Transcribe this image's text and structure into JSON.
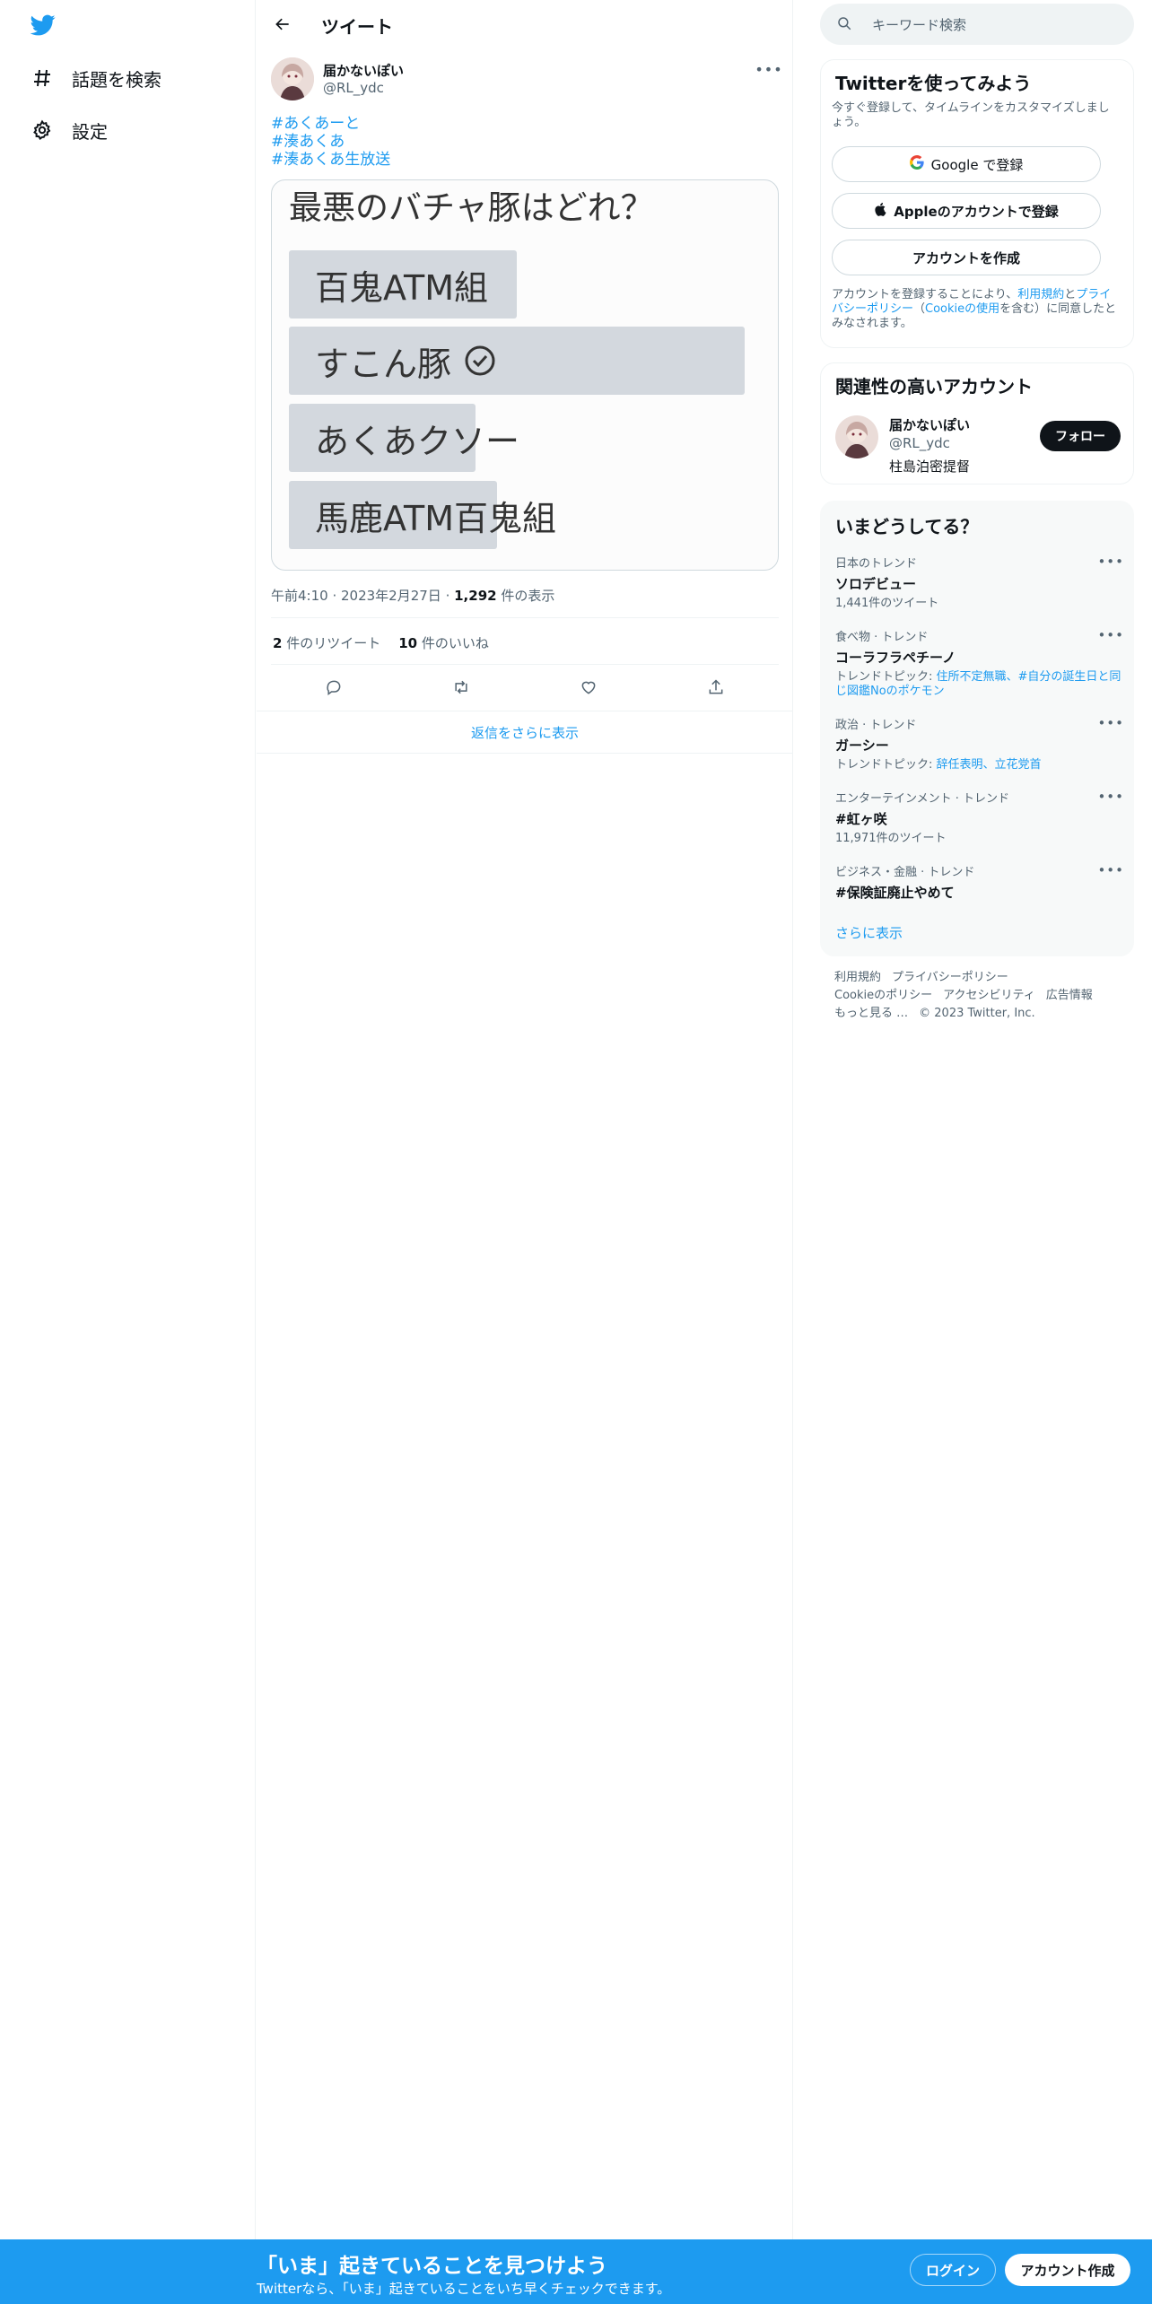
{
  "nav": {
    "items": [
      {
        "label": "話題を検索",
        "icon": "hashtag-icon"
      },
      {
        "label": "設定",
        "icon": "gear-icon"
      }
    ]
  },
  "header": {
    "title": "ツイート"
  },
  "tweet": {
    "author_name": "届かないぽい",
    "author_handle": "@RL_ydc",
    "hashtags": [
      "#あくあーと",
      "#湊あくあ",
      "#湊あくあ生放送"
    ],
    "poll_image": {
      "title": "最悪のバチャ豚はどれ？",
      "options": [
        {
          "label": "百鬼ATM組",
          "fill": 0.5,
          "checked": false
        },
        {
          "label": "すこん豚",
          "fill": 1.0,
          "checked": true
        },
        {
          "label": "あくあクソー",
          "fill": 0.41,
          "checked": false
        },
        {
          "label": "馬鹿ATM百鬼組",
          "fill": 0.46,
          "checked": false
        }
      ]
    },
    "time": "午前4:10",
    "date": "2023年2月27日",
    "views_count": "1,292",
    "views_label": "件の表示",
    "retweets_count": "2",
    "retweets_label": "件のリツイート",
    "likes_count": "10",
    "likes_label": "件のいいね",
    "more_replies": "返信をさらに表示"
  },
  "search": {
    "placeholder": "キーワード検索"
  },
  "signup_card": {
    "title": "Twitterを使ってみよう",
    "subtitle": "今すぐ登録して、タイムラインをカスタマイズしましょう。",
    "google_label": "Google で登録",
    "apple_label": "Appleのアカウントで登録",
    "create_label": "アカウントを作成",
    "terms_prefix": "アカウントを登録することにより、",
    "terms_link": "利用規約",
    "terms_and": "と",
    "privacy_link": "プライバシーポリシー",
    "cookie_paren_open": "（",
    "cookie_link": "Cookieの使用",
    "terms_suffix": "を含む）に同意したとみなされます。"
  },
  "related_card": {
    "title": "関連性の高いアカウント",
    "name": "届かないぽい",
    "handle": "@RL_ydc",
    "bio": "柱島泊密提督",
    "follow_label": "フォロー"
  },
  "trends_card": {
    "title": "いまどうしてる？",
    "trends": [
      {
        "category": "日本のトレンド",
        "name": "ソロデビュー",
        "sub": "1,441件のツイート"
      },
      {
        "category": "食べ物 · トレンド",
        "name": "コーラフラペチーノ",
        "sub_prefix": "トレンドトピック: ",
        "sub_links": "住所不定無職、#自分の誕生日と同じ図鑑Noのポケモン"
      },
      {
        "category": "政治 · トレンド",
        "name": "ガーシー",
        "sub_prefix": "トレンドトピック: ",
        "sub_links": "辞任表明、立花党首"
      },
      {
        "category": "エンターテインメント · トレンド",
        "name": "#虹ヶ咲",
        "sub": "11,971件のツイート"
      },
      {
        "category": "ビジネス・金融 · トレンド",
        "name": "#保険証廃止やめて",
        "sub": ""
      }
    ],
    "show_more": "さらに表示"
  },
  "footer": {
    "links": [
      "利用規約",
      "プライバシーポリシー",
      "Cookieのポリシー",
      "アクセシビリティ",
      "広告情報",
      "もっと見る …"
    ],
    "copyright": "© 2023 Twitter, Inc."
  },
  "banner": {
    "title": "「いま」起きていることを見つけよう",
    "subtitle": "Twitterなら、「いま」起きていることをいち早くチェックできます。",
    "login_label": "ログイン",
    "signup_label": "アカウント作成"
  },
  "colors": {
    "accent": "#1d9bf0",
    "text": "#0f1419",
    "secondary": "#536471"
  }
}
